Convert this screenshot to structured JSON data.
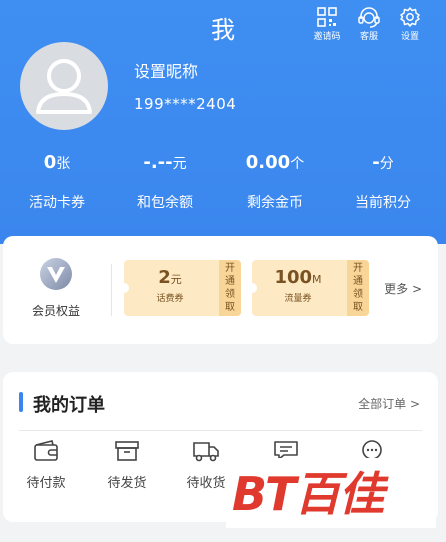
{
  "header": {
    "title": "我",
    "tools": [
      {
        "label": "邀请码",
        "icon": "qr-code-icon"
      },
      {
        "label": "客服",
        "icon": "customer-service-icon"
      },
      {
        "label": "设置",
        "icon": "settings-gear-icon"
      }
    ],
    "nickname": "设置昵称",
    "phone": "199****2404",
    "stats": [
      {
        "value": "0",
        "unit": "张",
        "label": "活动卡券"
      },
      {
        "value": "-.--",
        "unit": "元",
        "label": "和包余额"
      },
      {
        "value": "0.00",
        "unit": "个",
        "label": "剩余金币"
      },
      {
        "value": "-",
        "unit": "分",
        "label": "当前积分"
      }
    ]
  },
  "benefits": {
    "member_label": "会员权益",
    "coupons": [
      {
        "amount": "2",
        "unit": "元",
        "name": "话费券",
        "action_chars": [
          "开",
          "通",
          "领",
          "取"
        ]
      },
      {
        "amount": "100",
        "unit": "M",
        "name": "流量券",
        "action_chars": [
          "开",
          "通",
          "领",
          "取"
        ]
      }
    ],
    "more_label": "更多",
    "more_chevron": ">"
  },
  "orders": {
    "title": "我的订单",
    "all_label": "全部订单",
    "all_chevron": ">",
    "items": [
      {
        "label": "待付款",
        "icon": "wallet-icon"
      },
      {
        "label": "待发货",
        "icon": "package-box-icon"
      },
      {
        "label": "待收货",
        "icon": "delivery-truck-icon"
      },
      {
        "label": "",
        "icon": "review-message-icon"
      },
      {
        "label": "",
        "icon": "after-sales-chat-icon"
      }
    ]
  },
  "watermark": {
    "text": "BT百佳"
  },
  "colors": {
    "header_blue": "#3a86ee",
    "coupon_bg": "#fde9c4",
    "watermark_red": "#e03a2e"
  }
}
